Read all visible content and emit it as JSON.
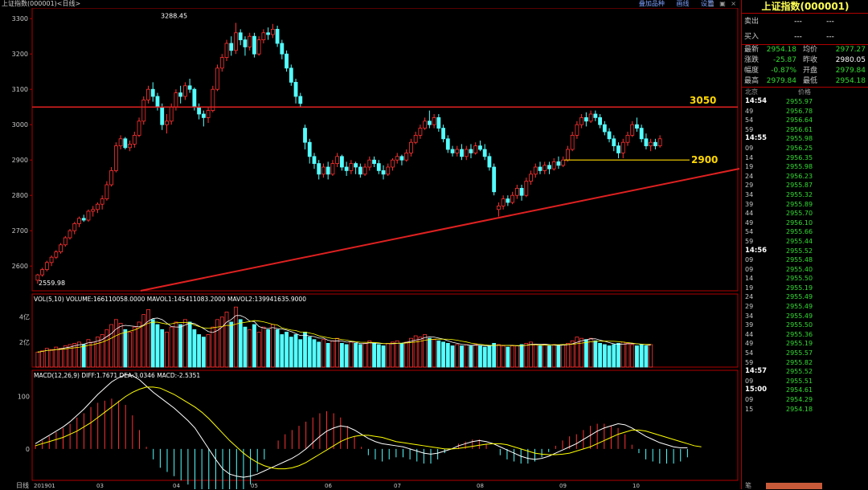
{
  "window": {
    "title": "上证指数(000001)<日线>",
    "links": [
      "叠加品种",
      "画线",
      "设置"
    ],
    "controls": "□ ▣ ×"
  },
  "price_axis": {
    "labels": [
      "3300",
      "3200",
      "3100",
      "3000",
      "2900",
      "2800",
      "2700",
      "2600"
    ],
    "values": [
      3300,
      3200,
      3100,
      3000,
      2900,
      2800,
      2700,
      2600
    ]
  },
  "annotations": {
    "high_label": "3288.45",
    "low_label": "2559.98",
    "resistance_label": "3050",
    "resistance_value": 3050,
    "support_label": "2900",
    "support_value": 2900
  },
  "volume_panel": {
    "header": "VOL(5,10) VOLUME:166110058.0000 MAVOL1:145411083.2000 MAVOL2:139941635.9000",
    "labels": [
      "4亿",
      "2亿"
    ]
  },
  "macd_panel": {
    "header": "MACD(12,26,9) DIFF:1.7671 DEA:3.0346 MACD:-2.5351",
    "labels": [
      "100",
      "0"
    ]
  },
  "x_axis": {
    "corner": "日线",
    "labels": [
      "201901",
      "03",
      "04",
      "05",
      "06",
      "07",
      "08",
      "09",
      "10"
    ]
  },
  "chart_data": {
    "type": "candlestick",
    "ylim": [
      2530,
      3330
    ],
    "candles": [
      [
        2560,
        2575,
        2550,
        2578
      ],
      [
        2575,
        2590,
        2570,
        2595
      ],
      [
        2590,
        2610,
        2585,
        2615
      ],
      [
        2610,
        2625,
        2600,
        2630
      ],
      [
        2625,
        2640,
        2620,
        2645
      ],
      [
        2640,
        2660,
        2635,
        2665
      ],
      [
        2660,
        2680,
        2655,
        2685
      ],
      [
        2680,
        2700,
        2675,
        2705
      ],
      [
        2700,
        2720,
        2690,
        2725
      ],
      [
        2720,
        2735,
        2710,
        2740
      ],
      [
        2735,
        2730,
        2725,
        2745
      ],
      [
        2730,
        2755,
        2725,
        2760
      ],
      [
        2755,
        2760,
        2740,
        2770
      ],
      [
        2760,
        2775,
        2750,
        2780
      ],
      [
        2775,
        2790,
        2760,
        2800
      ],
      [
        2790,
        2830,
        2785,
        2840
      ],
      [
        2830,
        2870,
        2825,
        2880
      ],
      [
        2870,
        2940,
        2865,
        2950
      ],
      [
        2940,
        2960,
        2930,
        2970
      ],
      [
        2960,
        2935,
        2930,
        2965
      ],
      [
        2935,
        2945,
        2925,
        2955
      ],
      [
        2945,
        2970,
        2935,
        2980
      ],
      [
        2970,
        3010,
        2965,
        3020
      ],
      [
        3010,
        3070,
        3000,
        3080
      ],
      [
        3070,
        3100,
        3060,
        3110
      ],
      [
        3100,
        3080,
        3065,
        3120
      ],
      [
        3080,
        3050,
        3040,
        3090
      ],
      [
        3050,
        3000,
        2985,
        3060
      ],
      [
        3000,
        3010,
        2975,
        3030
      ],
      [
        3010,
        3050,
        3000,
        3060
      ],
      [
        3050,
        3090,
        3040,
        3100
      ],
      [
        3090,
        3080,
        3060,
        3110
      ],
      [
        3080,
        3110,
        3070,
        3120
      ],
      [
        3110,
        3100,
        3090,
        3130
      ],
      [
        3100,
        3050,
        3040,
        3105
      ],
      [
        3050,
        3030,
        3015,
        3060
      ],
      [
        3030,
        3020,
        2995,
        3040
      ],
      [
        3020,
        3040,
        3005,
        3050
      ],
      [
        3040,
        3100,
        3035,
        3110
      ],
      [
        3100,
        3160,
        3095,
        3170
      ],
      [
        3160,
        3190,
        3150,
        3200
      ],
      [
        3190,
        3230,
        3180,
        3240
      ],
      [
        3230,
        3210,
        3195,
        3250
      ],
      [
        3210,
        3260,
        3200,
        3288
      ],
      [
        3260,
        3240,
        3225,
        3270
      ],
      [
        3240,
        3220,
        3195,
        3250
      ],
      [
        3220,
        3250,
        3210,
        3260
      ],
      [
        3250,
        3200,
        3190,
        3260
      ],
      [
        3200,
        3240,
        3195,
        3250
      ],
      [
        3240,
        3260,
        3230,
        3270
      ],
      [
        3260,
        3255,
        3240,
        3275
      ],
      [
        3255,
        3270,
        3245,
        3285
      ],
      [
        3270,
        3230,
        3220,
        3280
      ],
      [
        3230,
        3200,
        3185,
        3240
      ],
      [
        3200,
        3160,
        3150,
        3210
      ],
      [
        3160,
        3120,
        3110,
        3170
      ],
      [
        3120,
        3080,
        3060,
        3130
      ],
      [
        3080,
        3060,
        3050,
        3090
      ],
      [
        2990,
        2950,
        2930,
        3000
      ],
      [
        2950,
        2910,
        2890,
        2960
      ],
      [
        2910,
        2890,
        2875,
        2920
      ],
      [
        2890,
        2860,
        2845,
        2900
      ],
      [
        2860,
        2880,
        2850,
        2890
      ],
      [
        2880,
        2860,
        2845,
        2895
      ],
      [
        2860,
        2890,
        2855,
        2900
      ],
      [
        2890,
        2910,
        2880,
        2920
      ],
      [
        2910,
        2880,
        2870,
        2915
      ],
      [
        2880,
        2870,
        2855,
        2895
      ],
      [
        2870,
        2890,
        2860,
        2900
      ],
      [
        2890,
        2880,
        2860,
        2895
      ],
      [
        2880,
        2860,
        2850,
        2890
      ],
      [
        2860,
        2880,
        2855,
        2890
      ],
      [
        2880,
        2900,
        2870,
        2910
      ],
      [
        2900,
        2890,
        2880,
        2910
      ],
      [
        2890,
        2870,
        2860,
        2900
      ],
      [
        2870,
        2860,
        2845,
        2885
      ],
      [
        2860,
        2880,
        2855,
        2890
      ],
      [
        2880,
        2900,
        2870,
        2905
      ],
      [
        2900,
        2910,
        2890,
        2920
      ],
      [
        2910,
        2900,
        2885,
        2915
      ],
      [
        2900,
        2920,
        2895,
        2930
      ],
      [
        2920,
        2950,
        2910,
        2960
      ],
      [
        2950,
        2970,
        2945,
        2980
      ],
      [
        2970,
        2990,
        2960,
        3000
      ],
      [
        2990,
        3010,
        2985,
        3020
      ],
      [
        3010,
        3000,
        2990,
        3040
      ],
      [
        3000,
        3020,
        2990,
        3030
      ],
      [
        3020,
        2990,
        2980,
        3030
      ],
      [
        2990,
        2960,
        2950,
        3000
      ],
      [
        2960,
        2930,
        2920,
        2970
      ],
      [
        2930,
        2920,
        2910,
        2940
      ],
      [
        2920,
        2930,
        2910,
        2940
      ],
      [
        2930,
        2910,
        2900,
        2945
      ],
      [
        2910,
        2930,
        2900,
        2940
      ],
      [
        2930,
        2920,
        2905,
        2945
      ],
      [
        2920,
        2940,
        2915,
        2950
      ],
      [
        2940,
        2930,
        2925,
        2955
      ],
      [
        2930,
        2910,
        2900,
        2945
      ],
      [
        2910,
        2880,
        2870,
        2920
      ],
      [
        2880,
        2810,
        2800,
        2890
      ],
      [
        2760,
        2770,
        2740,
        2780
      ],
      [
        2770,
        2790,
        2760,
        2800
      ],
      [
        2790,
        2780,
        2770,
        2800
      ],
      [
        2780,
        2800,
        2775,
        2810
      ],
      [
        2800,
        2820,
        2790,
        2830
      ],
      [
        2820,
        2800,
        2785,
        2830
      ],
      [
        2800,
        2840,
        2795,
        2850
      ],
      [
        2840,
        2860,
        2830,
        2870
      ],
      [
        2860,
        2880,
        2850,
        2890
      ],
      [
        2880,
        2870,
        2860,
        2895
      ],
      [
        2870,
        2885,
        2860,
        2895
      ],
      [
        2885,
        2875,
        2860,
        2895
      ],
      [
        2875,
        2895,
        2870,
        2905
      ],
      [
        2895,
        2885,
        2875,
        2910
      ],
      [
        2885,
        2900,
        2880,
        2910
      ],
      [
        2900,
        2930,
        2895,
        2940
      ],
      [
        2930,
        2970,
        2925,
        2980
      ],
      [
        2970,
        3000,
        2960,
        3010
      ],
      [
        3000,
        3020,
        2990,
        3030
      ],
      [
        3020,
        3010,
        2995,
        3035
      ],
      [
        3010,
        3030,
        3005,
        3040
      ],
      [
        3030,
        3020,
        3010,
        3040
      ],
      [
        3020,
        3000,
        2990,
        3030
      ],
      [
        3000,
        2980,
        2970,
        3010
      ],
      [
        2980,
        2960,
        2950,
        2990
      ],
      [
        2960,
        2940,
        2925,
        2970
      ],
      [
        2940,
        2920,
        2905,
        2950
      ],
      [
        2920,
        2950,
        2905,
        2960
      ],
      [
        2950,
        2970,
        2940,
        2980
      ],
      [
        2970,
        3000,
        2965,
        3010
      ],
      [
        3000,
        2990,
        2980,
        3020
      ],
      [
        2990,
        2960,
        2950,
        3000
      ],
      [
        2960,
        2940,
        2930,
        2975
      ],
      [
        2940,
        2950,
        2925,
        2960
      ],
      [
        2950,
        2940,
        2930,
        2960
      ],
      [
        2940,
        2960,
        2935,
        2970
      ]
    ],
    "volume": [
      1.2,
      1.3,
      1.5,
      1.4,
      1.6,
      1.5,
      1.7,
      1.8,
      1.9,
      2.0,
      1.8,
      2.2,
      2.0,
      2.4,
      2.6,
      3.0,
      3.4,
      3.8,
      3.5,
      3.0,
      2.8,
      3.2,
      3.6,
      4.2,
      4.6,
      3.8,
      3.4,
      3.0,
      2.8,
      3.2,
      3.6,
      3.4,
      3.8,
      3.6,
      3.0,
      2.6,
      2.4,
      2.6,
      3.2,
      3.8,
      4.0,
      4.4,
      3.6,
      4.8,
      3.8,
      3.2,
      3.0,
      3.4,
      2.8,
      3.2,
      3.0,
      3.4,
      3.0,
      2.6,
      2.8,
      2.4,
      2.6,
      2.2,
      2.8,
      2.4,
      2.2,
      2.0,
      2.2,
      1.9,
      2.1,
      2.3,
      1.9,
      1.8,
      2.0,
      1.9,
      1.8,
      1.9,
      2.1,
      1.9,
      1.8,
      1.7,
      1.9,
      2.0,
      2.1,
      1.9,
      2.0,
      2.3,
      2.5,
      2.4,
      2.6,
      2.3,
      2.2,
      2.1,
      2.0,
      1.9,
      1.7,
      1.8,
      1.7,
      1.8,
      1.7,
      1.8,
      1.7,
      1.6,
      1.7,
      1.9,
      1.8,
      1.7,
      1.6,
      1.7,
      1.7,
      1.8,
      1.9,
      2.0,
      1.8,
      1.7,
      1.8,
      1.7,
      1.8,
      1.7,
      1.8,
      1.9,
      2.1,
      2.4,
      2.3,
      2.2,
      2.3,
      2.1,
      1.9,
      1.8,
      1.7,
      1.8,
      1.9,
      2.0,
      1.9,
      1.8,
      1.7,
      1.8,
      1.7,
      1.8
    ],
    "macd": {
      "ylim": [
        -60,
        150
      ],
      "diff": [
        10,
        18,
        26,
        34,
        42,
        52,
        64,
        76,
        90,
        104,
        116,
        128,
        136,
        142,
        140,
        132,
        120,
        108,
        98,
        88,
        78,
        66,
        54,
        40,
        20,
        0,
        -20,
        -38,
        -48,
        -52,
        -54,
        -52,
        -48,
        -42,
        -36,
        -30,
        -24,
        -18,
        -10,
        0,
        12,
        24,
        34,
        40,
        44,
        42,
        36,
        28,
        20,
        14,
        10,
        8,
        6,
        4,
        0,
        -4,
        -8,
        -10,
        -8,
        -4,
        0,
        6,
        10,
        14,
        16,
        14,
        10,
        4,
        -2,
        -8,
        -14,
        -18,
        -20,
        -18,
        -14,
        -8,
        -2,
        4,
        10,
        18,
        26,
        34,
        40,
        44,
        48,
        46,
        40,
        32,
        24,
        18,
        12,
        8,
        4,
        2,
        2
      ],
      "dea": [
        6,
        10,
        14,
        18,
        22,
        28,
        34,
        42,
        50,
        60,
        70,
        80,
        90,
        100,
        108,
        114,
        118,
        118,
        116,
        110,
        104,
        96,
        88,
        80,
        70,
        58,
        44,
        30,
        16,
        4,
        -8,
        -18,
        -26,
        -32,
        -36,
        -38,
        -38,
        -36,
        -32,
        -26,
        -18,
        -10,
        -2,
        6,
        14,
        20,
        24,
        26,
        26,
        24,
        22,
        18,
        14,
        12,
        10,
        8,
        6,
        4,
        2,
        0,
        0,
        1,
        3,
        5,
        7,
        9,
        10,
        10,
        8,
        4,
        0,
        -4,
        -8,
        -10,
        -11,
        -11,
        -10,
        -8,
        -4,
        0,
        4,
        10,
        16,
        22,
        28,
        32,
        36,
        36,
        34,
        30,
        26,
        22,
        18,
        14,
        10,
        6,
        4
      ],
      "hist_color_rule": "red when diff>dea, cyan otherwise"
    }
  },
  "quote_panel": {
    "title": "上证指数(000001)",
    "sell_label": "卖出",
    "sell_v1": "---",
    "sell_v2": "---",
    "buy_label": "买入",
    "buy_v1": "---",
    "buy_v2": "---",
    "rows": [
      {
        "l1": "最新",
        "v1": "2954.18",
        "c1": "green",
        "l2": "均价",
        "v2": "2977.27",
        "c2": "green"
      },
      {
        "l1": "涨跌",
        "v1": "-25.87",
        "c1": "green",
        "l2": "昨收",
        "v2": "2980.05",
        "c2": "white"
      },
      {
        "l1": "幅度",
        "v1": "-0.87%",
        "c1": "green",
        "l2": "开盘",
        "v2": "2979.84",
        "c2": "green"
      },
      {
        "l1": "最高",
        "v1": "2979.84",
        "c1": "green",
        "l2": "最低",
        "v2": "2954.18",
        "c2": "green"
      }
    ],
    "tick_header_left": "北京",
    "tick_header_right": "价格",
    "ticks": [
      {
        "t": "14:54",
        "p": "2955.97",
        "b": true
      },
      {
        "t": "49",
        "p": "2956.78"
      },
      {
        "t": "54",
        "p": "2956.64"
      },
      {
        "t": "59",
        "p": "2956.61"
      },
      {
        "t": "14:55",
        "p": "2955.98",
        "b": true
      },
      {
        "t": "09",
        "p": "2956.25"
      },
      {
        "t": "14",
        "p": "2956.35"
      },
      {
        "t": "19",
        "p": "2955.98"
      },
      {
        "t": "24",
        "p": "2956.23"
      },
      {
        "t": "29",
        "p": "2955.87"
      },
      {
        "t": "34",
        "p": "2955.32"
      },
      {
        "t": "39",
        "p": "2955.89"
      },
      {
        "t": "44",
        "p": "2955.70"
      },
      {
        "t": "49",
        "p": "2956.10"
      },
      {
        "t": "54",
        "p": "2955.66"
      },
      {
        "t": "59",
        "p": "2955.44"
      },
      {
        "t": "14:56",
        "p": "2955.52",
        "b": true
      },
      {
        "t": "09",
        "p": "2955.48"
      },
      {
        "t": "09",
        "p": "2955.40"
      },
      {
        "t": "14",
        "p": "2955.50"
      },
      {
        "t": "19",
        "p": "2955.19"
      },
      {
        "t": "24",
        "p": "2955.49"
      },
      {
        "t": "29",
        "p": "2955.49"
      },
      {
        "t": "34",
        "p": "2955.49"
      },
      {
        "t": "39",
        "p": "2955.50"
      },
      {
        "t": "44",
        "p": "2955.36"
      },
      {
        "t": "49",
        "p": "2955.19"
      },
      {
        "t": "54",
        "p": "2955.57"
      },
      {
        "t": "59",
        "p": "2955.82"
      },
      {
        "t": "14:57",
        "p": "2955.52",
        "b": true
      },
      {
        "t": "09",
        "p": "2955.51"
      },
      {
        "t": "15:00",
        "p": "2954.61",
        "b": true
      },
      {
        "t": "09",
        "p": "2954.29"
      },
      {
        "t": "15",
        "p": "2954.18"
      }
    ],
    "foot_label": "笔"
  }
}
